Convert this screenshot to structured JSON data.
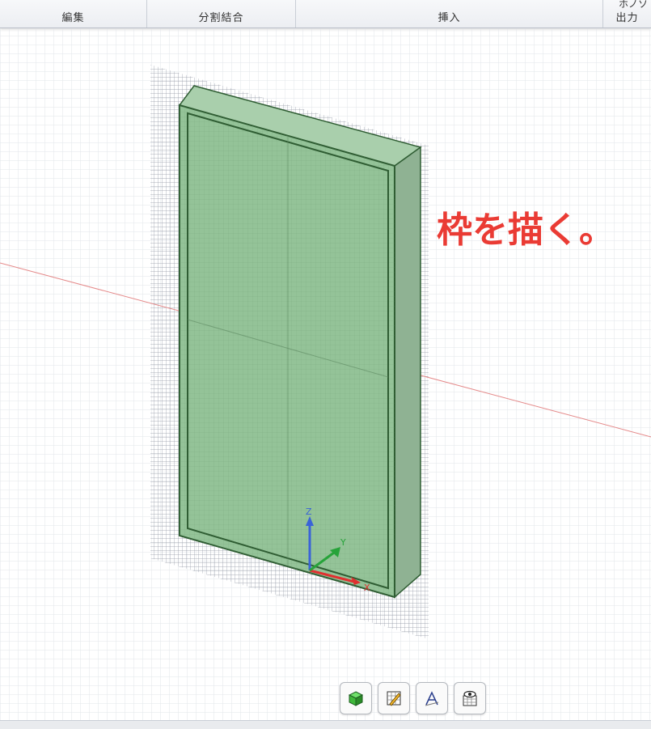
{
  "ribbon": {
    "groups": [
      {
        "label": "編集"
      },
      {
        "label": "分割結合"
      },
      {
        "label": "挿入"
      },
      {
        "label": "出力",
        "top_label": "ホノソ"
      }
    ]
  },
  "viewport": {
    "axis_labels": {
      "x": "X",
      "y": "Y",
      "z": "Z"
    },
    "model_color": "#8fbf93",
    "edge_color": "#2f5d33"
  },
  "caption": "枠を描く。",
  "view_tools": [
    {
      "icon": "solid-view-icon"
    },
    {
      "icon": "sketch-view-icon"
    },
    {
      "icon": "dimension-view-icon"
    },
    {
      "icon": "visibility-view-icon"
    }
  ]
}
